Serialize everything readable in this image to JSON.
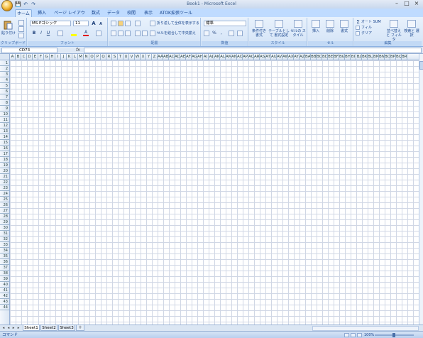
{
  "app": {
    "title": "Book1 - Microsoft Excel"
  },
  "qat": {
    "save": "💾",
    "undo": "↶",
    "redo": "↷"
  },
  "tabs": [
    {
      "label": "ホーム"
    },
    {
      "label": "挿入"
    },
    {
      "label": "ページ レイアウト"
    },
    {
      "label": "数式"
    },
    {
      "label": "データ"
    },
    {
      "label": "校閲"
    },
    {
      "label": "表示"
    },
    {
      "label": "ATOK拡張ツール"
    }
  ],
  "ribbon": {
    "clipboard": {
      "label": "クリップボード",
      "paste": "貼り付け"
    },
    "font": {
      "label": "フォント",
      "family": "MS Pゴシック",
      "size": "11",
      "bold": "B",
      "italic": "I",
      "underline": "U",
      "grow": "A",
      "shrink": "A",
      "color": "A"
    },
    "alignment": {
      "label": "配置",
      "wrap": "折り返して全体を表示する",
      "merge": "セルを結合して中央揃え"
    },
    "number": {
      "label": "数値",
      "format": "標準",
      "pct": "%",
      "comma": ","
    },
    "styles": {
      "label": "スタイル",
      "cond": "条件付き 書式",
      "table": "テーブルとして 書式設定",
      "cell": "セルの スタイル"
    },
    "cells": {
      "label": "セル",
      "insert": "挿入",
      "delete": "削除",
      "format": "書式"
    },
    "editing": {
      "label": "編集",
      "autosum": "オート SUM",
      "fill": "フィル",
      "clear": "クリア",
      "sort": "並べ替えと フィルタ",
      "find": "検索と 選択"
    }
  },
  "formula": {
    "namebox": "CD73",
    "fx": "fx"
  },
  "columns": [
    "A",
    "B",
    "C",
    "D",
    "E",
    "F",
    "G",
    "H",
    "I",
    "J",
    "K",
    "L",
    "M",
    "N",
    "O",
    "P",
    "Q",
    "R",
    "S",
    "T",
    "U",
    "V",
    "W",
    "X",
    "Y",
    "Z",
    "AA",
    "AB",
    "AC",
    "AD",
    "AE",
    "AF",
    "AG",
    "AH",
    "AI",
    "AJ",
    "AK",
    "AL",
    "AM",
    "AN",
    "AO",
    "AP",
    "AQ",
    "AR",
    "AS",
    "AT",
    "AU",
    "AV",
    "AW",
    "AX",
    "AY",
    "AZ",
    "BA",
    "BB",
    "BC",
    "BD",
    "BE",
    "BF",
    "BG",
    "BH",
    "BI",
    "BJ",
    "BK",
    "BL",
    "BM",
    "BN",
    "BO",
    "BP",
    "BQ",
    "BR"
  ],
  "rows": [
    "1",
    "2",
    "3",
    "4",
    "5",
    "6",
    "7",
    "8",
    "9",
    "10",
    "11",
    "12",
    "13",
    "14",
    "15",
    "16",
    "17",
    "18",
    "19",
    "20",
    "21",
    "22",
    "23",
    "24",
    "25",
    "26",
    "27",
    "28",
    "29",
    "30",
    "31",
    "32",
    "33",
    "34",
    "35",
    "36",
    "37",
    "38",
    "39",
    "40",
    "41",
    "42",
    "43",
    "44"
  ],
  "sheets": [
    {
      "name": "Sheet1"
    },
    {
      "name": "Sheet2"
    },
    {
      "name": "Sheet3"
    }
  ],
  "status": {
    "text": "コマンド",
    "zoom": "100%"
  }
}
